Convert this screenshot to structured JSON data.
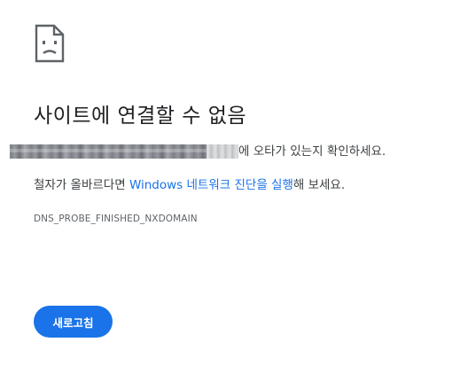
{
  "error": {
    "icon": "sad-document-icon",
    "title": "사이트에 연결할 수 없음",
    "line1_suffix": "에 오타가 있는지 확인하세요.",
    "line2_prefix": "철자가 올바르다면 ",
    "line2_link": "Windows 네트워크 진단을 실행",
    "line2_suffix": "해 보세요.",
    "code": "DNS_PROBE_FINISHED_NXDOMAIN"
  },
  "actions": {
    "reload_label": "새로고침"
  },
  "colors": {
    "accent": "#1a73e8",
    "text": "#202124",
    "secondary_text": "#5f6368"
  }
}
